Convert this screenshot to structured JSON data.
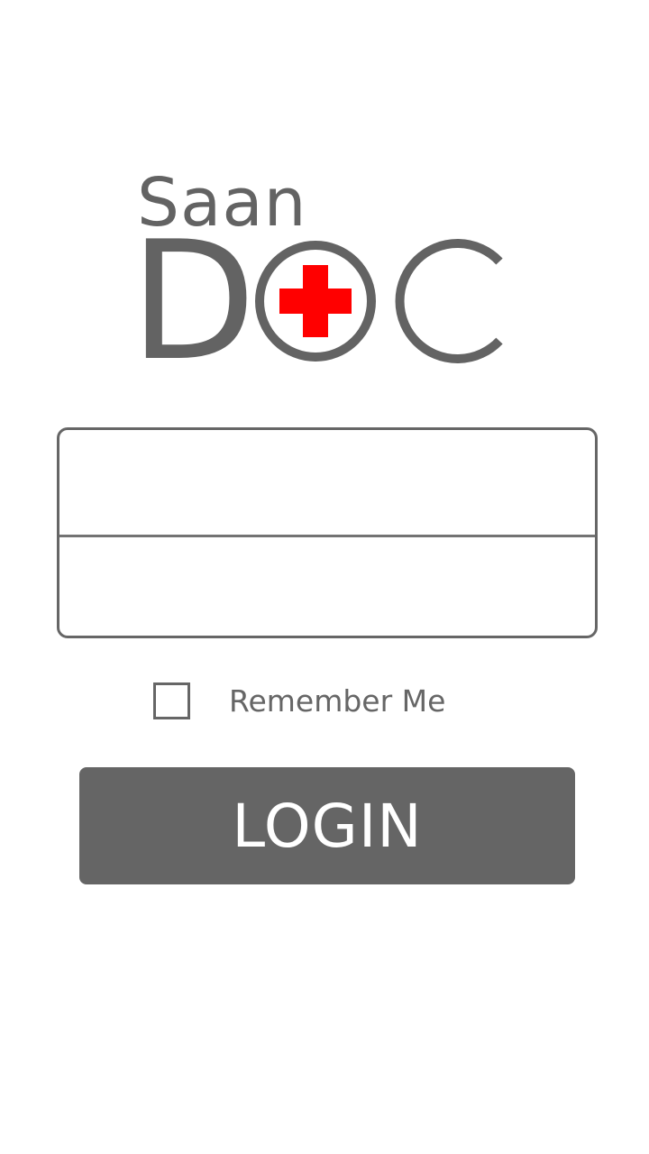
{
  "logo": {
    "top_text": "Saan",
    "d_letter": "D",
    "c_letter": "C",
    "text_color": "#636363",
    "cross_color": "#ff0000"
  },
  "form": {
    "username_placeholder": "",
    "password_placeholder": "",
    "username_value": "",
    "password_value": ""
  },
  "remember": {
    "label": "Remember Me",
    "checked": false
  },
  "login_button": {
    "label": "LOGIN",
    "color": "#656565"
  }
}
